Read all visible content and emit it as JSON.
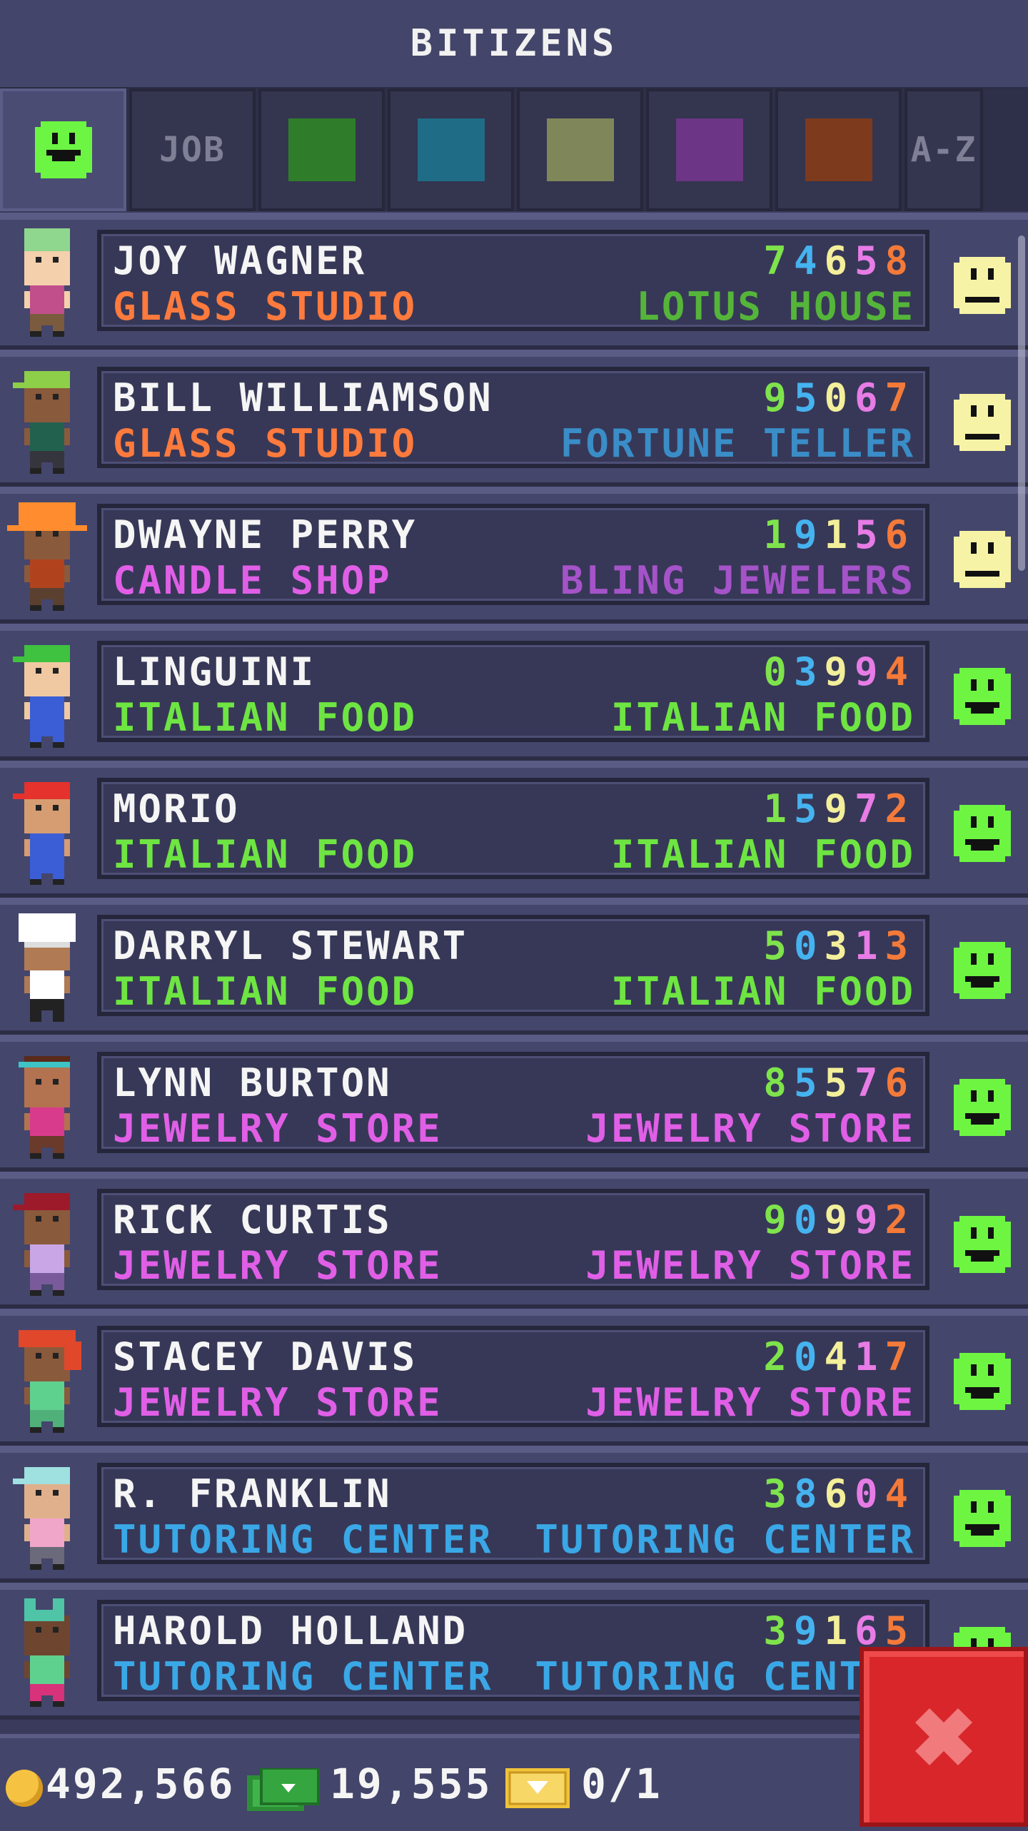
{
  "header": {
    "title": "BITIZENS"
  },
  "tabs": [
    {
      "type": "face",
      "label": "",
      "color": "#6cf542",
      "active": true
    },
    {
      "type": "text",
      "label": "JOB"
    },
    {
      "type": "swatch",
      "label": "",
      "color": "#2f7d2b"
    },
    {
      "type": "swatch",
      "label": "",
      "color": "#1f6c86"
    },
    {
      "type": "swatch",
      "label": "",
      "color": "#7f875a"
    },
    {
      "type": "swatch",
      "label": "",
      "color": "#6c3585"
    },
    {
      "type": "swatch",
      "label": "",
      "color": "#7d3a1d"
    },
    {
      "type": "text",
      "label": "A-Z"
    }
  ],
  "colors": {
    "green": "#6ee542",
    "orange": "#ff7a3d",
    "pink": "#e05fe6",
    "lightgreen": "#55b53a",
    "blue": "#3aa7e6",
    "purple": "#a553c9",
    "happy": "#6ef542",
    "neutral": "#f6f3a6"
  },
  "digit_colors": [
    "#7fe34c",
    "#45b3ef",
    "#f3ef9a",
    "#e77ce6",
    "#f47a3a"
  ],
  "bitizens": [
    {
      "name": "JOY WAGNER",
      "job": "GLASS STUDIO",
      "job_color": "#ff7a3d",
      "home": "LOTUS HOUSE",
      "home_color": "#55b53a",
      "id": "74658",
      "mood": "neutral",
      "avatar": {
        "hat": "#8fd68f",
        "hat_type": "beanie",
        "skin": "#f4d0ac",
        "shirt": "#c04f8c",
        "pants": "#7b5b3d"
      }
    },
    {
      "name": "BILL WILLIAMSON",
      "job": "GLASS STUDIO",
      "job_color": "#ff7a3d",
      "home": "FORTUNE TELLER",
      "home_color": "#3a8dc7",
      "id": "95067",
      "mood": "neutral",
      "avatar": {
        "hat": "#8dcf49",
        "hat_type": "cap",
        "skin": "#8a5a3c",
        "shirt": "#23614f",
        "pants": "#35363d"
      }
    },
    {
      "name": "DWAYNE PERRY",
      "job": "CANDLE SHOP",
      "job_color": "#e05fe6",
      "home": "BLING JEWELERS",
      "home_color": "#a553c9",
      "id": "19156",
      "mood": "neutral",
      "avatar": {
        "hat": "#ff8c2e",
        "hat_type": "hardhat",
        "skin": "#8a5a3c",
        "shirt": "#b0431d",
        "pants": "#5b4030"
      }
    },
    {
      "name": "LINGUINI",
      "job": "ITALIAN FOOD",
      "job_color": "#6ee542",
      "home": "ITALIAN FOOD",
      "home_color": "#6ee542",
      "id": "03994",
      "mood": "happy",
      "avatar": {
        "hat": "#3fc23f",
        "hat_type": "cap",
        "skin": "#f0c9a2",
        "shirt": "#3b5ed6",
        "pants": "#3b5ed6"
      }
    },
    {
      "name": "MORIO",
      "job": "ITALIAN FOOD",
      "job_color": "#6ee542",
      "home": "ITALIAN FOOD",
      "home_color": "#6ee542",
      "id": "15972",
      "mood": "happy",
      "avatar": {
        "hat": "#e5322d",
        "hat_type": "cap",
        "skin": "#d69c72",
        "shirt": "#3b5ed6",
        "pants": "#3b5ed6"
      }
    },
    {
      "name": "DARRYL STEWART",
      "job": "ITALIAN FOOD",
      "job_color": "#6ee542",
      "home": "ITALIAN FOOD",
      "home_color": "#6ee542",
      "id": "50313",
      "mood": "happy",
      "avatar": {
        "hat": "#ffffff",
        "hat_type": "chef",
        "skin": "#b07a55",
        "shirt": "#ffffff",
        "pants": "#222222"
      }
    },
    {
      "name": "LYNN BURTON",
      "job": "JEWELRY STORE",
      "job_color": "#e05fe6",
      "home": "JEWELRY STORE",
      "home_color": "#e05fe6",
      "id": "85576",
      "mood": "happy",
      "avatar": {
        "hat": "#3ec4c4",
        "hat_type": "band",
        "skin": "#b37250",
        "shirt": "#d83b8c",
        "pants": "#6a3a2a"
      }
    },
    {
      "name": "RICK CURTIS",
      "job": "JEWELRY STORE",
      "job_color": "#e05fe6",
      "home": "JEWELRY STORE",
      "home_color": "#e05fe6",
      "id": "90992",
      "mood": "happy",
      "avatar": {
        "hat": "#9c1a2a",
        "hat_type": "cap",
        "skin": "#8a5a3c",
        "shirt": "#c9a6e6",
        "pants": "#7a5a9a"
      }
    },
    {
      "name": "STACEY DAVIS",
      "job": "JEWELRY STORE",
      "job_color": "#e05fe6",
      "home": "JEWELRY STORE",
      "home_color": "#e05fe6",
      "id": "20417",
      "mood": "happy",
      "avatar": {
        "hat": "#e0472b",
        "hat_type": "hair",
        "skin": "#8a5a3c",
        "shirt": "#5fd18f",
        "pants": "#4fb07a"
      }
    },
    {
      "name": "R. FRANKLIN",
      "job": "TUTORING CENTER",
      "job_color": "#3aa7e6",
      "home": "TUTORING CENTER",
      "home_color": "#3aa7e6",
      "id": "38604",
      "mood": "happy",
      "avatar": {
        "hat": "#9fe0e0",
        "hat_type": "cap",
        "skin": "#e0b08c",
        "shirt": "#f0a6c9",
        "pants": "#6a6a7a"
      }
    },
    {
      "name": "HAROLD HOLLAND",
      "job": "TUTORING CENTER",
      "job_color": "#3aa7e6",
      "home": "TUTORING CENTER",
      "home_color": "#3aa7e6",
      "id": "39165",
      "mood": "happy",
      "avatar": {
        "hat": "#4fc4a6",
        "hat_type": "bow",
        "skin": "#6e4630",
        "shirt": "#5fd18f",
        "pants": "#d8327a"
      }
    }
  ],
  "footer": {
    "coins": "492,566",
    "bux": "19,555",
    "tickets": "0/1"
  },
  "close": {
    "icon": "close-icon"
  }
}
